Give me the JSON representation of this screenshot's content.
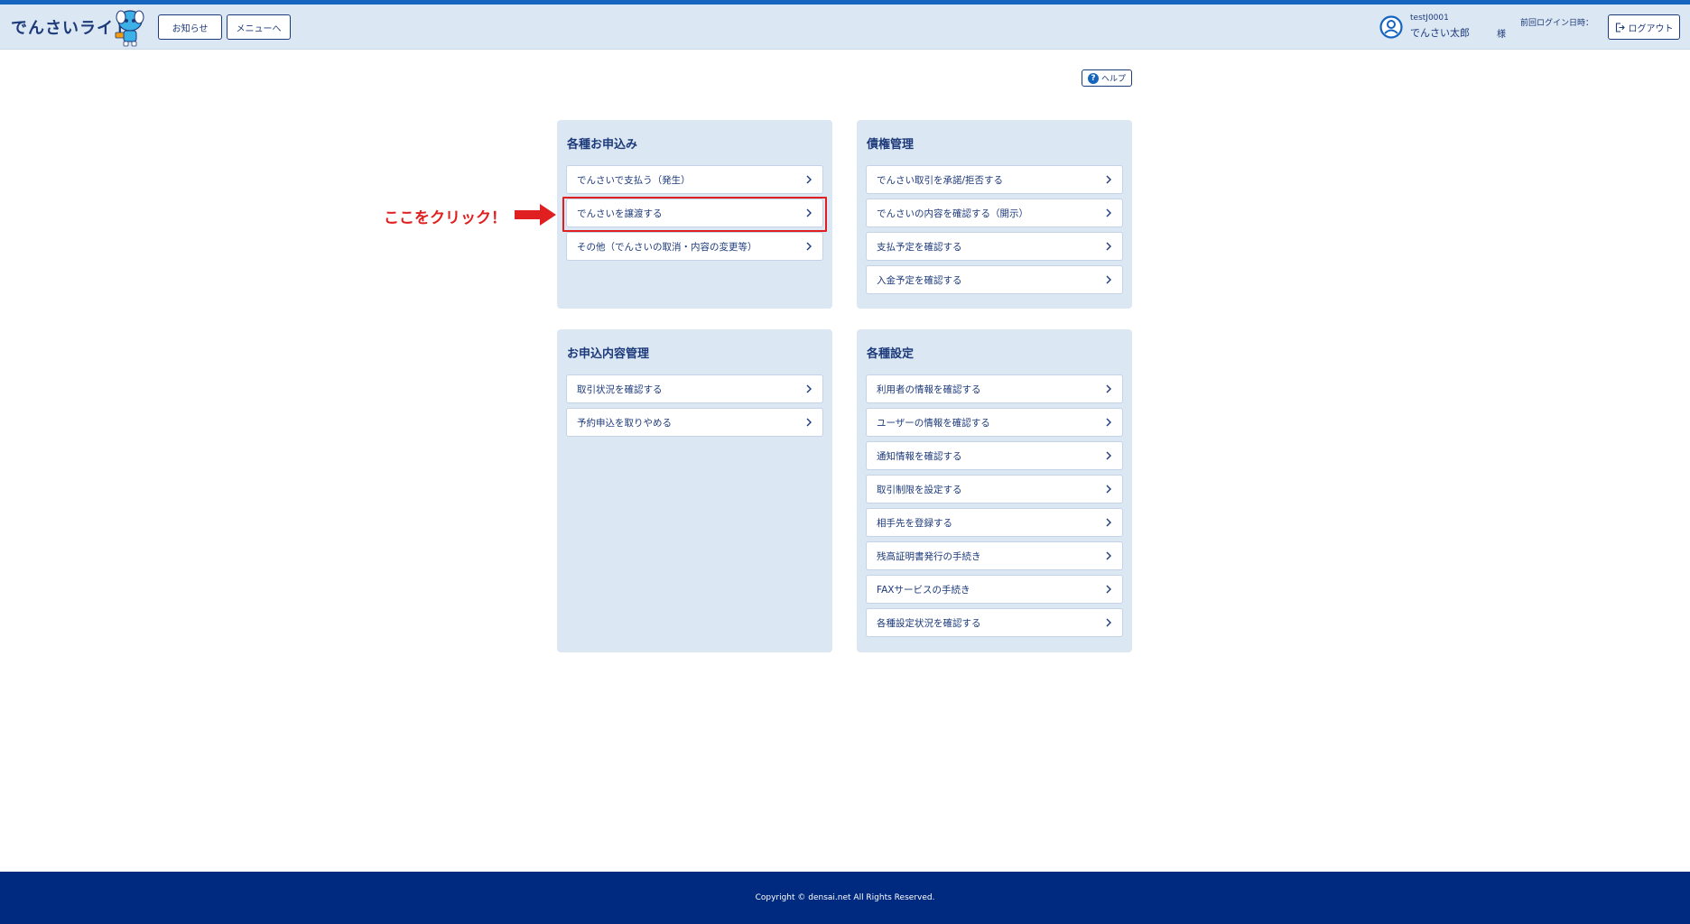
{
  "header": {
    "logo": "でんさいライト",
    "buttons": {
      "news": "お知らせ",
      "menu": "メニューへ"
    },
    "user": {
      "id": "testJ0001",
      "name": "でんさい太郎",
      "honorific": "様"
    },
    "last_login_label": "前回ログイン日時：",
    "logout_label": "ログアウト"
  },
  "help_label": "ヘルプ",
  "annotation": {
    "text": "ここをクリック！"
  },
  "panels": {
    "applications": {
      "title": "各種お申込み",
      "items": [
        "でんさいで支払う（発生）",
        "でんさいを譲渡する",
        "その他（でんさいの取消・内容の変更等）"
      ]
    },
    "claims": {
      "title": "債権管理",
      "items": [
        "でんさい取引を承諾/拒否する",
        "でんさいの内容を確認する（開示）",
        "支払予定を確認する",
        "入金予定を確認する"
      ]
    },
    "history": {
      "title": "お申込内容管理",
      "items": [
        "取引状況を確認する",
        "予約申込を取りやめる"
      ]
    },
    "settings": {
      "title": "各種設定",
      "items": [
        "利用者の情報を確認する",
        "ユーザーの情報を確認する",
        "通知情報を確認する",
        "取引制限を設定する",
        "相手先を登録する",
        "残高証明書発行の手続き",
        "FAXサービスの手続き",
        "各種設定状況を確認する"
      ]
    }
  },
  "footer": {
    "copyright": "Copyright © densai.net All Rights Reserved."
  },
  "colors": {
    "header_bg": "#dbe7f3",
    "panel_bg": "#dbe7f3",
    "text": "#1d3a7a",
    "accent": "#1565c0",
    "annotation": "#e02020",
    "footer_bg": "#002a7f"
  }
}
